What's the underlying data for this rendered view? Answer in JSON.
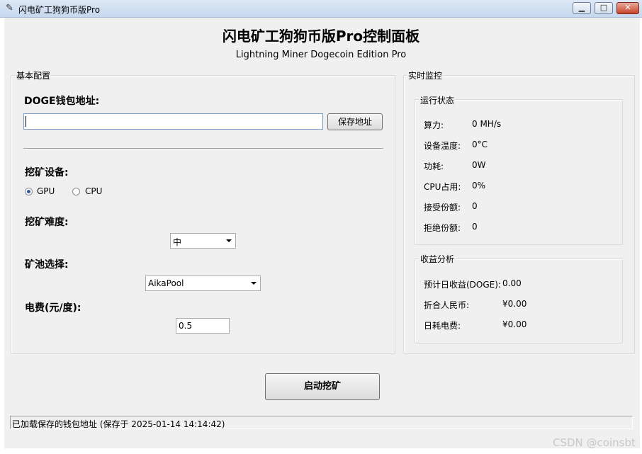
{
  "window": {
    "title": "闪电矿工狗狗币版Pro",
    "feather_icon": "feather-icon",
    "buttons": {
      "minimize": "▭",
      "maximize": "□",
      "close": "✕"
    }
  },
  "header": {
    "title": "闪电矿工狗狗币版Pro控制面板",
    "subtitle": "Lightning Miner Dogecoin Edition Pro"
  },
  "config": {
    "title": "基本配置",
    "wallet_label": "DOGE钱包地址:",
    "wallet_value": "",
    "save_button": "保存地址",
    "device_label": "挖矿设备:",
    "device_options": [
      "GPU",
      "CPU"
    ],
    "device_selected": "GPU",
    "difficulty_label": "挖矿难度:",
    "difficulty_value": "中",
    "pool_label": "矿池选择:",
    "pool_value": "AikaPool",
    "electricity_label": "电费(元/度):",
    "electricity_value": "0.5"
  },
  "monitor": {
    "title": "实时监控",
    "status_title": "运行状态",
    "status_rows": [
      {
        "label": "算力:",
        "value": "0 MH/s"
      },
      {
        "label": "设备温度:",
        "value": "0°C"
      },
      {
        "label": "功耗:",
        "value": "0W"
      },
      {
        "label": "CPU占用:",
        "value": "0%"
      },
      {
        "label": "接受份额:",
        "value": "0"
      },
      {
        "label": "拒绝份额:",
        "value": "0"
      }
    ],
    "profit_title": "收益分析",
    "profit_rows": [
      {
        "label": "预计日收益(DOGE):",
        "value": "0.00"
      },
      {
        "label": "折合人民币:",
        "value": "¥0.00"
      },
      {
        "label": "日耗电费:",
        "value": "¥0.00"
      }
    ]
  },
  "start_button": "启动挖矿",
  "status_bar": "已加载保存的钱包地址 (保存于 2025-01-14 14:14:42)",
  "watermark": "CSDN @coinsbt"
}
